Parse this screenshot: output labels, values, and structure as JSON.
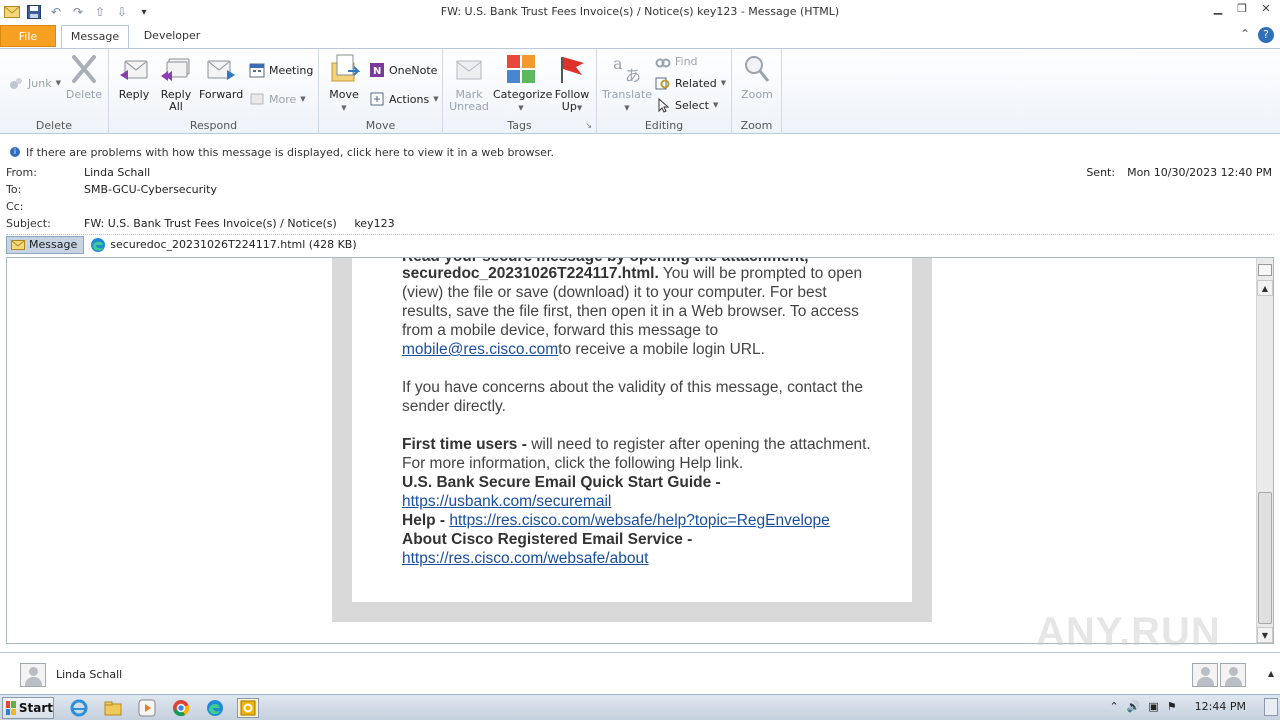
{
  "window": {
    "title": "FW: U.S. Bank Trust Fees Invoice(s) / Notice(s)    key123  -  Message (HTML)"
  },
  "tabs": [
    "File",
    "Message",
    "Developer"
  ],
  "ribbon": {
    "delete_group": {
      "label": "Delete",
      "junk": "Junk",
      "delete": "Delete"
    },
    "respond_group": {
      "label": "Respond",
      "reply": "Reply",
      "reply_all_1": "Reply",
      "reply_all_2": "All",
      "forward": "Forward",
      "meeting": "Meeting",
      "more": "More"
    },
    "move_group": {
      "label": "Move",
      "move": "Move",
      "onenote": "OneNote",
      "actions": "Actions"
    },
    "tags_group": {
      "label": "Tags",
      "mark_unread_1": "Mark",
      "mark_unread_2": "Unread",
      "categorize": "Categorize",
      "follow_up_1": "Follow",
      "follow_up_2": "Up"
    },
    "editing_group": {
      "label": "Editing",
      "translate": "Translate",
      "find": "Find",
      "related": "Related",
      "select": "Select"
    },
    "zoom_group": {
      "label": "Zoom",
      "zoom": "Zoom"
    }
  },
  "infobar": "If there are problems with how this message is displayed, click here to view it in a web browser.",
  "header": {
    "from_label": "From:",
    "from": "Linda Schall",
    "to_label": "To:",
    "to": "SMB-GCU-Cybersecurity",
    "cc_label": "Cc:",
    "cc": "",
    "subject_label": "Subject:",
    "subject": "FW: U.S. Bank Trust Fees Invoice(s) / Notice(s)     key123",
    "sent_label": "Sent:",
    "sent": "Mon 10/30/2023 12:40 PM"
  },
  "attachments": {
    "message_tab": "Message",
    "file": "securedoc_20231026T224117.html (428 KB)"
  },
  "body": {
    "cut_line": "Read your secure message by opening the attachment,",
    "p1_bold": "securedoc_20231026T224117.html.",
    "p1_text": " You will be prompted to open (view) the file or save (download) it to your computer. For best results, save the file first, then open it in a Web browser. To access from a mobile device, forward this message to ",
    "p1_link": "mobile@res.cisco.com",
    "p1_tail": "to receive a mobile login URL.",
    "p2": "If you have concerns about the validity of this message, contact the sender directly.",
    "p3_bold": "First time users - ",
    "p3_text": "will need to register after opening the attachment. For more information, click the following Help link.",
    "guide_title": "U.S. Bank Secure Email Quick Start Guide -",
    "guide_link": "https://usbank.com/securemail",
    "help_label": "Help - ",
    "help_link": "https://res.cisco.com/websafe/help?topic=RegEnvelope",
    "about_title": "About Cisco Registered Email Service -",
    "about_link": "https://res.cisco.com/websafe/about"
  },
  "people_pane": {
    "name": "Linda Schall"
  },
  "taskbar": {
    "start": "Start",
    "time": "12:44 PM"
  },
  "watermark": "ANY.RUN"
}
